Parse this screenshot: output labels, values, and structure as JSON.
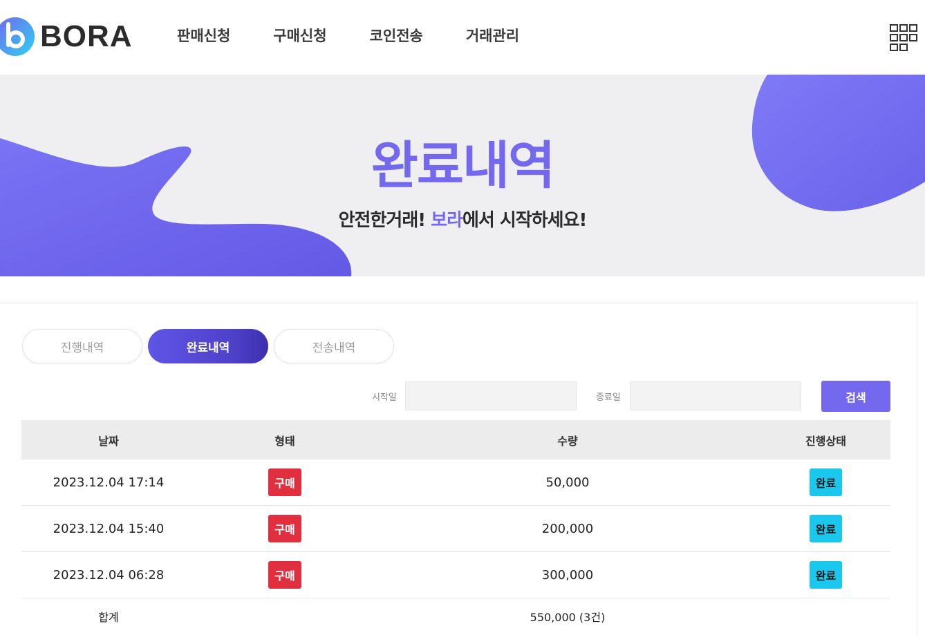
{
  "brand": {
    "name": "BORA",
    "primary_color": "#7368ee",
    "logo_gradient": [
      "#7168f0",
      "#2fd0f0"
    ]
  },
  "nav": {
    "items": [
      {
        "label": "판매신청"
      },
      {
        "label": "구매신청"
      },
      {
        "label": "코인전송"
      },
      {
        "label": "거래관리"
      }
    ],
    "menu_icon": "grid-menu-icon"
  },
  "hero": {
    "title": "완료내역",
    "subtitle_before": "안전한거래! ",
    "subtitle_accent": "보라",
    "subtitle_after": "에서 시작하세요!"
  },
  "tabs": [
    {
      "label": "진행내역",
      "active": false
    },
    {
      "label": "완료내역",
      "active": true
    },
    {
      "label": "전송내역",
      "active": false
    }
  ],
  "search": {
    "start_label": "시작일",
    "start_value": "",
    "end_label": "종료일",
    "end_value": "",
    "button_label": "검색"
  },
  "table": {
    "columns": [
      "날짜",
      "형태",
      "수량",
      "진행상태"
    ],
    "rows": [
      {
        "date": "2023.12.04 17:14",
        "type": "구매",
        "amount": "50,000",
        "status": "완료"
      },
      {
        "date": "2023.12.04 15:40",
        "type": "구매",
        "amount": "200,000",
        "status": "완료"
      },
      {
        "date": "2023.12.04 06:28",
        "type": "구매",
        "amount": "300,000",
        "status": "완료"
      }
    ],
    "total": {
      "label": "합계",
      "value": "550,000 (3건)"
    },
    "colors": {
      "type_badge": "#e0303f",
      "status_badge": "#1ac8ee"
    }
  }
}
